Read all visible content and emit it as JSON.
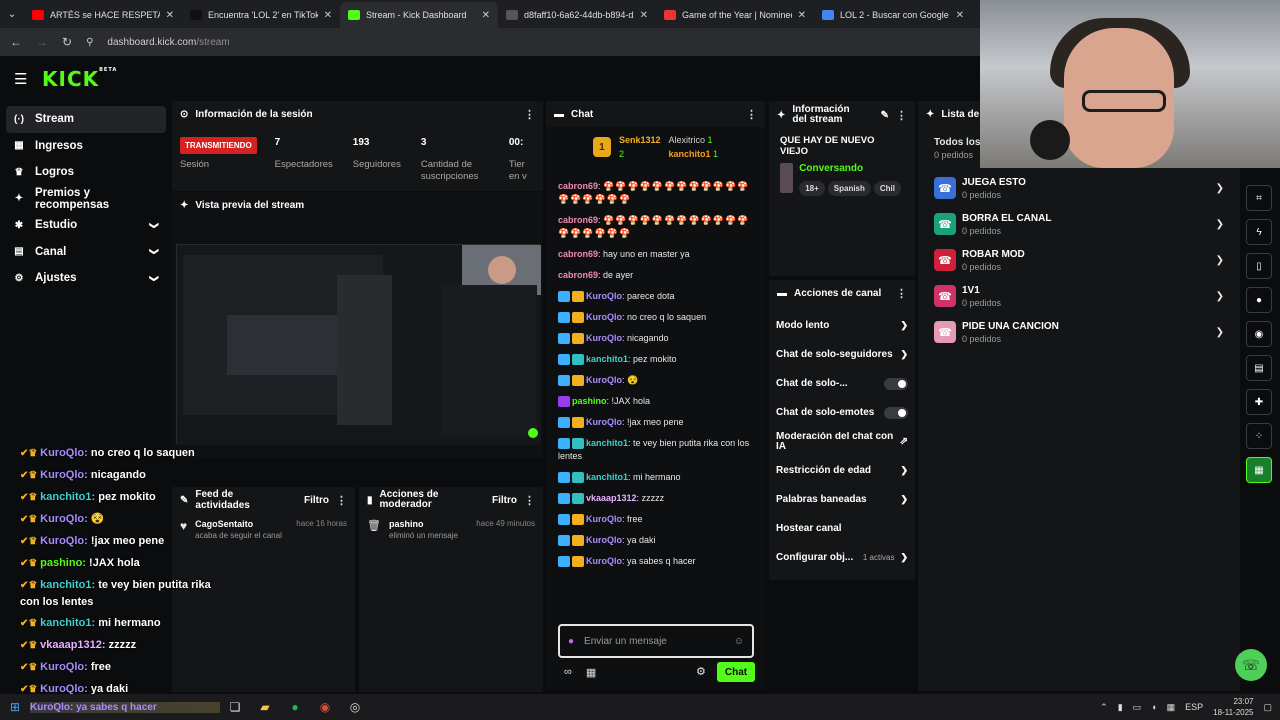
{
  "browser": {
    "tabs": [
      {
        "title": "ARTÉS se HACE RESPETAR frente",
        "color": "#ff0000",
        "active": false
      },
      {
        "title": "Encuentra 'LOL 2' en TikTok | Bu",
        "color": "#111111",
        "active": false
      },
      {
        "title": "Stream - Kick Dashboard",
        "color": "#53fc18",
        "active": true
      },
      {
        "title": "d8faff10-6a62-44db-b894-d25",
        "color": "#555555",
        "active": false
      },
      {
        "title": "Game of the Year | Nominees |",
        "color": "#e33",
        "active": false
      },
      {
        "title": "LOL 2 - Buscar con Google",
        "color": "#4285f4",
        "active": false
      }
    ],
    "url_host": "dashboard.kick.com",
    "url_path": "/stream"
  },
  "logo": {
    "text": "KICK",
    "sup": "BETA"
  },
  "sidebar": {
    "items": [
      {
        "label": "Stream",
        "icon": "signal-icon",
        "glyph": "(·)",
        "active": true,
        "expand": false
      },
      {
        "label": "Ingresos",
        "icon": "wallet-icon",
        "glyph": "▦",
        "active": false,
        "expand": false
      },
      {
        "label": "Logros",
        "icon": "trophy-icon",
        "glyph": "♛",
        "active": false,
        "expand": false
      },
      {
        "label": "Premios y recompensas",
        "icon": "gift-icon",
        "glyph": "✦",
        "active": false,
        "expand": false
      },
      {
        "label": "Estudio",
        "icon": "studio-icon",
        "glyph": "✱",
        "active": false,
        "expand": true
      },
      {
        "label": "Canal",
        "icon": "channel-icon",
        "glyph": "▤",
        "active": false,
        "expand": true
      },
      {
        "label": "Ajustes",
        "icon": "gear-icon",
        "glyph": "⚙",
        "active": false,
        "expand": true
      }
    ]
  },
  "session": {
    "title": "Información de la sesión",
    "status_badge": "TRANSMITIENDO",
    "status_label": "Sesión",
    "stats": [
      {
        "value": "7",
        "label": "Espectadores"
      },
      {
        "value": "193",
        "label": "Seguidores"
      },
      {
        "value": "3",
        "label": "Cantidad de suscripciones"
      },
      {
        "value": "00:",
        "label": "Tier en v"
      }
    ]
  },
  "preview": {
    "title": "Vista previa del stream"
  },
  "feed": {
    "title": "Feed de actividades",
    "filter": "Filtro",
    "item": {
      "who": "CagoSentaito",
      "what": "acaba de seguir el canal",
      "when": "hace 16 horas"
    }
  },
  "mod": {
    "title": "Acciones de moderador",
    "filter": "Filtro",
    "item": {
      "who": "pashino",
      "what": "eliminó un mensaje",
      "when": "hace 49 minutos"
    }
  },
  "chat": {
    "title": "Chat",
    "gifters": {
      "first": {
        "name": "Senk1312",
        "count": "2"
      },
      "second": {
        "name": "Alexitrico",
        "count": "1"
      },
      "third": {
        "name": "kanchito1",
        "count": "1"
      }
    },
    "messages": [
      {
        "user": "cabron69",
        "color": "#f08ab0",
        "text": "🍄🍄🍄🍄🍄🍄🍄🍄🍄🍄🍄🍄🍄🍄🍄🍄🍄🍄",
        "badges": []
      },
      {
        "user": "cabron69",
        "color": "#f08ab0",
        "text": "🍄🍄🍄🍄🍄🍄🍄🍄🍄🍄🍄🍄🍄🍄🍄🍄🍄🍄",
        "badges": []
      },
      {
        "user": "cabron69",
        "color": "#f08ab0",
        "text": "hay uno en master ya",
        "badges": []
      },
      {
        "user": "cabron69",
        "color": "#f08ab0",
        "text": "de ayer",
        "badges": []
      },
      {
        "user": "KuroQlo",
        "color": "#a98bff",
        "text": "parece dota",
        "badges": [
          "#3ab0ff",
          "#f2b01e"
        ]
      },
      {
        "user": "KuroQlo",
        "color": "#a98bff",
        "text": "no creo q lo saquen",
        "badges": [
          "#3ab0ff",
          "#f2b01e"
        ]
      },
      {
        "user": "KuroQlo",
        "color": "#a98bff",
        "text": "nicagando",
        "badges": [
          "#3ab0ff",
          "#f2b01e"
        ]
      },
      {
        "user": "kanchito1",
        "color": "#3fd0d0",
        "text": "pez mokito",
        "badges": [
          "#3ab0ff",
          "#30c0c0"
        ]
      },
      {
        "user": "KuroQlo",
        "color": "#a98bff",
        "text": "😵",
        "badges": [
          "#3ab0ff",
          "#f2b01e"
        ]
      },
      {
        "user": "pashino",
        "color": "#53fc18",
        "text": "!JAX hola",
        "badges": [
          "#9b3cf0"
        ]
      },
      {
        "user": "KuroQlo",
        "color": "#a98bff",
        "text": "!jax meo pene",
        "badges": [
          "#3ab0ff",
          "#f2b01e"
        ]
      },
      {
        "user": "kanchito1",
        "color": "#3fd0d0",
        "text": "te vey bien putita rika con los lentes",
        "badges": [
          "#3ab0ff",
          "#30c0c0"
        ]
      },
      {
        "user": "kanchito1",
        "color": "#3fd0d0",
        "text": "mi hermano",
        "badges": [
          "#3ab0ff",
          "#30c0c0"
        ]
      },
      {
        "user": "vkaaap1312",
        "color": "#e5b3ff",
        "text": "zzzzz",
        "badges": [
          "#3ab0ff",
          "#30c0c0"
        ]
      },
      {
        "user": "KuroQlo",
        "color": "#a98bff",
        "text": "free",
        "badges": [
          "#3ab0ff",
          "#f2b01e"
        ]
      },
      {
        "user": "KuroQlo",
        "color": "#a98bff",
        "text": "ya daki",
        "badges": [
          "#3ab0ff",
          "#f2b01e"
        ]
      },
      {
        "user": "KuroQlo",
        "color": "#a98bff",
        "text": "ya sabes q hacer",
        "badges": [
          "#3ab0ff",
          "#f2b01e"
        ]
      }
    ],
    "placeholder": "Enviar un mensaje",
    "send_label": "Chat"
  },
  "channel_info": {
    "title": "Información del stream",
    "stream_title": "QUE HAY DE NUEVO VIEJO",
    "category": "Conversando",
    "tags": [
      "18+",
      "Spanish",
      "Chil"
    ]
  },
  "channel_actions": {
    "title": "Acciones de canal",
    "items": [
      {
        "label": "Modo lento",
        "kind": "chevron"
      },
      {
        "label": "Chat de solo-seguidores",
        "kind": "chevron"
      },
      {
        "label": "Chat de solo-...",
        "kind": "toggle"
      },
      {
        "label": "Chat de solo-emotes",
        "kind": "toggle"
      },
      {
        "label": "Moderación del chat con IA",
        "kind": "link"
      },
      {
        "label": "Restricción de edad",
        "kind": "chevron"
      },
      {
        "label": "Palabras baneadas",
        "kind": "chevron"
      },
      {
        "label": "Hostear canal",
        "kind": "none"
      },
      {
        "label": "Configurar obj...",
        "kind": "chevron",
        "extra": "1 activas"
      }
    ]
  },
  "requests": {
    "title": "Lista de p",
    "all_label": "Todos los",
    "all_sub": "0 pedidos",
    "items": [
      {
        "title": "JUEGA ESTO",
        "sub": "0 pedidos",
        "color": "#3a6fd8"
      },
      {
        "title": "BORRA EL CANAL",
        "sub": "0 pedidos",
        "color": "#1aa37a"
      },
      {
        "title": "ROBAR MOD",
        "sub": "0 pedidos",
        "color": "#d0213a"
      },
      {
        "title": "1V1",
        "sub": "0 pedidos",
        "color": "#d0336a"
      },
      {
        "title": "PIDE UNA CANCION",
        "sub": "0 pedidos",
        "color": "#e79ab5"
      }
    ]
  },
  "overlay": {
    "lines": [
      {
        "user": "KuroQlo",
        "color": "#a98bff",
        "text": "no creo q lo saquen"
      },
      {
        "user": "KuroQlo",
        "color": "#a98bff",
        "text": "nicagando"
      },
      {
        "user": "kanchito1",
        "color": "#3fd0d0",
        "text": "pez mokito"
      },
      {
        "user": "KuroQlo",
        "color": "#a98bff",
        "text": "😵"
      },
      {
        "user": "KuroQlo",
        "color": "#a98bff",
        "text": "!jax meo pene"
      },
      {
        "user": "pashino",
        "color": "#53fc18",
        "text": "!JAX hola"
      },
      {
        "user": "kanchito1",
        "color": "#3fd0d0",
        "text": "te vey bien putita rika con los lentes"
      },
      {
        "user": "kanchito1",
        "color": "#3fd0d0",
        "text": "mi hermano"
      },
      {
        "user": "vkaaap1312",
        "color": "#e5b3ff",
        "text": "zzzzz"
      },
      {
        "user": "KuroQlo",
        "color": "#a98bff",
        "text": "free"
      },
      {
        "user": "KuroQlo",
        "color": "#a98bff",
        "text": "ya daki"
      }
    ]
  },
  "taskbar": {
    "typing": "KuroQlo: ya sabes q hacer",
    "lang": "ESP",
    "time": "23:07",
    "date": "18-11-2025"
  },
  "accent": "#53fc18"
}
